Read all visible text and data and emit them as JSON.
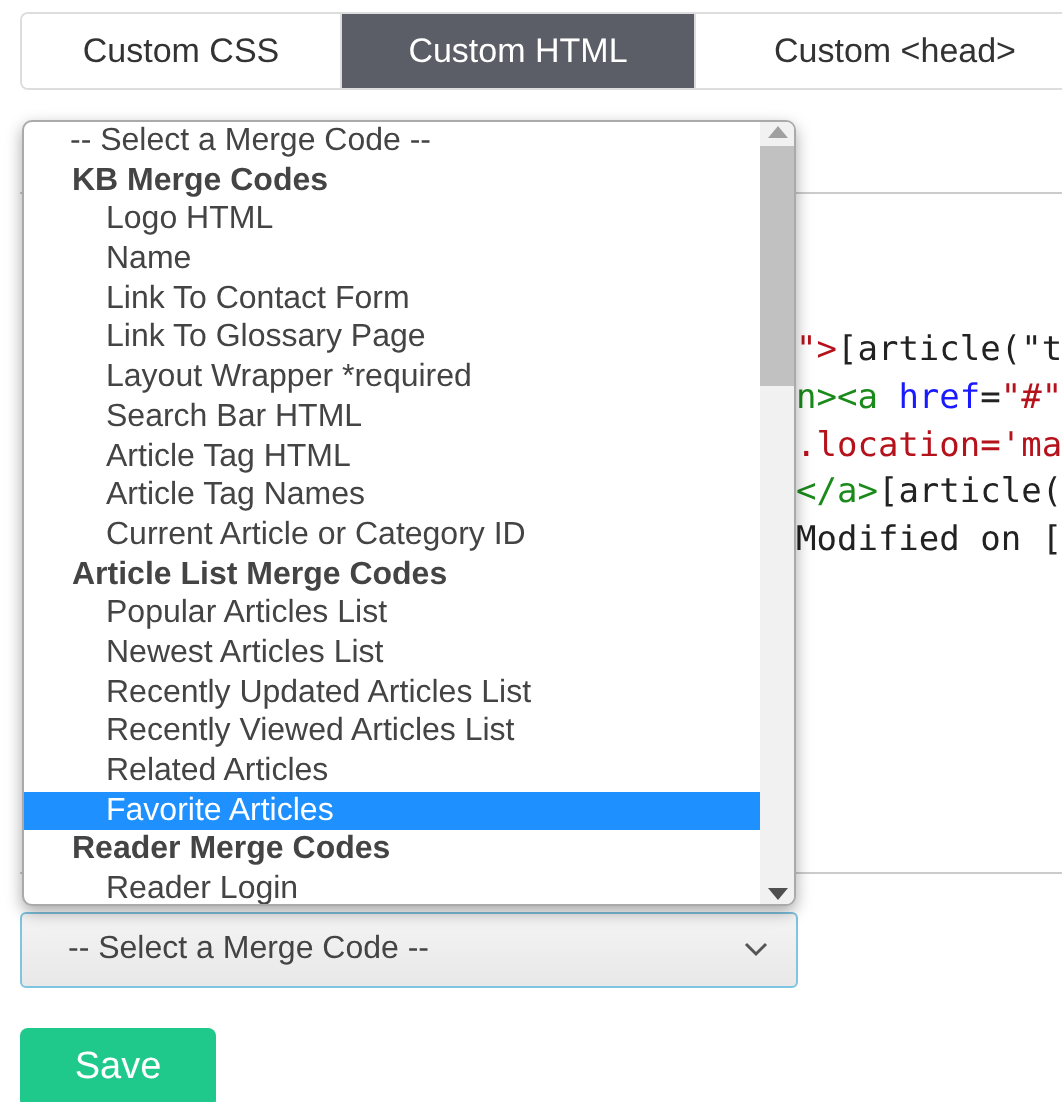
{
  "tabs": [
    {
      "label": "Custom CSS",
      "selected": false
    },
    {
      "label": "Custom HTML",
      "selected": true
    },
    {
      "label": "Custom <head>",
      "selected": false
    }
  ],
  "editor": {
    "lines": [
      [
        {
          "kind": "string",
          "text": "\">"
        },
        {
          "kind": "text",
          "text": "[article(\"t"
        }
      ],
      [
        {
          "kind": "tag",
          "text": "n><a"
        },
        {
          "kind": "attr",
          "text": " href"
        },
        {
          "kind": "text",
          "text": "="
        },
        {
          "kind": "string",
          "text": "\"#\""
        }
      ],
      [
        {
          "kind": "string",
          "text": ".location='ma"
        }
      ],
      [
        {
          "kind": "tag",
          "text": "</a>"
        },
        {
          "kind": "text",
          "text": "[article("
        }
      ],
      [
        {
          "kind": "text",
          "text": "Modified on ["
        }
      ]
    ]
  },
  "merge_list": {
    "items": [
      {
        "kind": "placeholder",
        "label": "-- Select a Merge Code --",
        "selected": false
      },
      {
        "kind": "group",
        "label": "KB Merge Codes"
      },
      {
        "kind": "option",
        "label": "Logo HTML",
        "selected": false
      },
      {
        "kind": "option",
        "label": "Name",
        "selected": false
      },
      {
        "kind": "option",
        "label": "Link To Contact Form",
        "selected": false
      },
      {
        "kind": "option",
        "label": "Link To Glossary Page",
        "selected": false
      },
      {
        "kind": "option",
        "label": "Layout Wrapper *required",
        "selected": false
      },
      {
        "kind": "option",
        "label": "Search Bar HTML",
        "selected": false
      },
      {
        "kind": "option",
        "label": "Article Tag HTML",
        "selected": false
      },
      {
        "kind": "option",
        "label": "Article Tag Names",
        "selected": false
      },
      {
        "kind": "option",
        "label": "Current Article or Category ID",
        "selected": false
      },
      {
        "kind": "group",
        "label": "Article List Merge Codes"
      },
      {
        "kind": "option",
        "label": "Popular Articles List",
        "selected": false
      },
      {
        "kind": "option",
        "label": "Newest Articles List",
        "selected": false
      },
      {
        "kind": "option",
        "label": "Recently Updated Articles List",
        "selected": false
      },
      {
        "kind": "option",
        "label": "Recently Viewed Articles List",
        "selected": false
      },
      {
        "kind": "option",
        "label": "Related Articles",
        "selected": false
      },
      {
        "kind": "option",
        "label": "Favorite Articles",
        "selected": true
      },
      {
        "kind": "group",
        "label": "Reader Merge Codes"
      },
      {
        "kind": "option",
        "label": "Reader Login",
        "selected": false
      }
    ]
  },
  "merge_select": {
    "value": "-- Select a Merge Code --"
  },
  "save_button": {
    "label": "Save"
  }
}
